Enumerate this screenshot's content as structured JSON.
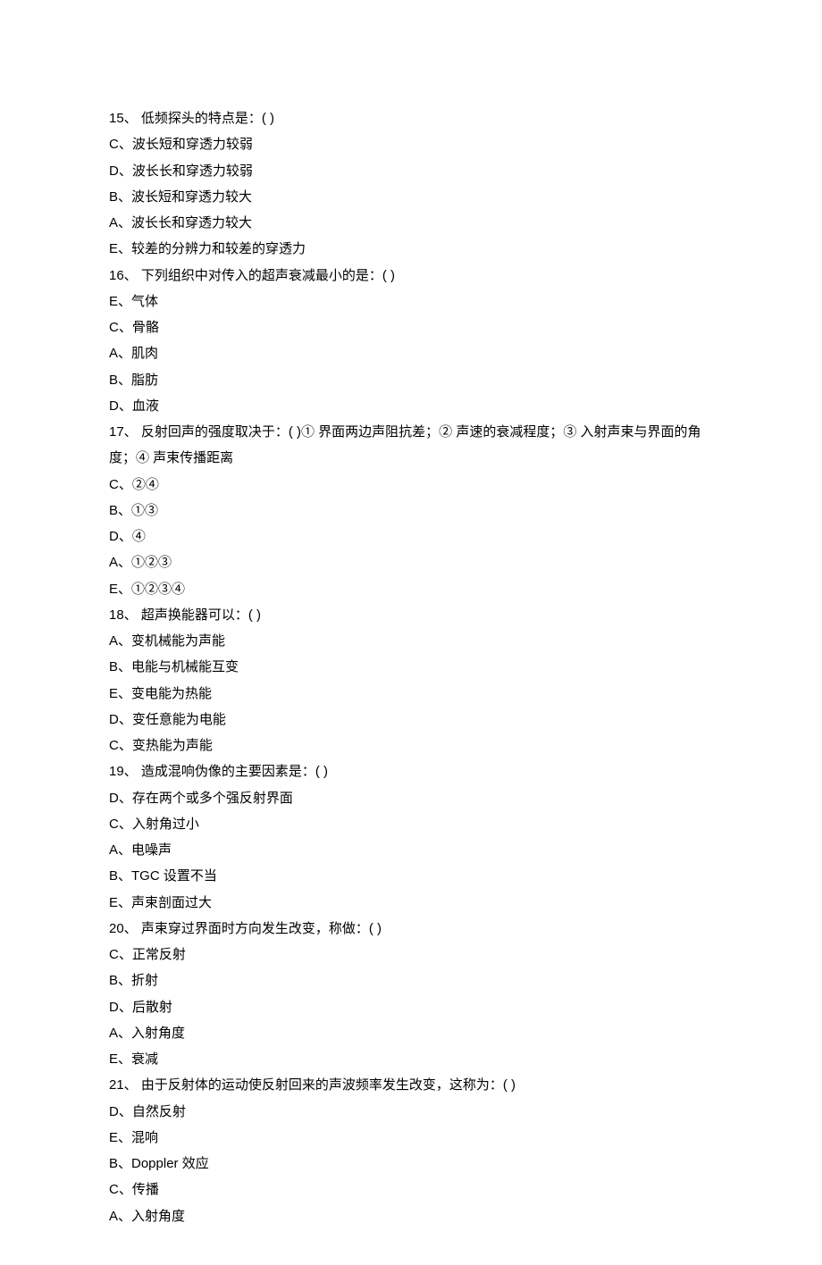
{
  "questions": [
    {
      "num": "15、",
      "stem": "低频探头的特点是：( )",
      "options": [
        "C、波长短和穿透力较弱",
        "D、波长长和穿透力较弱",
        "B、波长短和穿透力较大",
        "A、波长长和穿透力较大",
        "E、较差的分辨力和较差的穿透力"
      ]
    },
    {
      "num": "16、",
      "stem": "下列组织中对传入的超声衰减最小的是：( )",
      "options": [
        "E、气体",
        "C、骨骼",
        "A、肌肉",
        "B、脂肪",
        "D、血液"
      ]
    },
    {
      "num": "17、",
      "stem": "反射回声的强度取决于：( )① 界面两边声阻抗差；② 声速的衰减程度；③ 入射声束与界面的角度；④ 声束传播距离",
      "options": [
        "C、②④",
        "B、①③",
        "D、④",
        "A、①②③",
        "E、①②③④"
      ]
    },
    {
      "num": "18、",
      "stem": "超声换能器可以：( )",
      "options": [
        "A、变机械能为声能",
        "B、电能与机械能互变",
        "E、变电能为热能",
        "D、变任意能为电能",
        "C、变热能为声能"
      ]
    },
    {
      "num": "19、",
      "stem": "造成混响伪像的主要因素是：( )",
      "options": [
        "D、存在两个或多个强反射界面",
        "C、入射角过小",
        "A、电噪声",
        "B、TGC 设置不当",
        "E、声束剖面过大"
      ]
    },
    {
      "num": "20、",
      "stem": "声束穿过界面时方向发生改变，称做：( )",
      "options": [
        "C、正常反射",
        "B、折射",
        "D、后散射",
        "A、入射角度",
        "E、衰减"
      ]
    },
    {
      "num": "21、",
      "stem": "由于反射体的运动使反射回来的声波频率发生改变，这称为：( )",
      "options": [
        "D、自然反射",
        "E、混响",
        "B、Doppler 效应",
        "C、传播",
        "A、入射角度"
      ]
    }
  ]
}
